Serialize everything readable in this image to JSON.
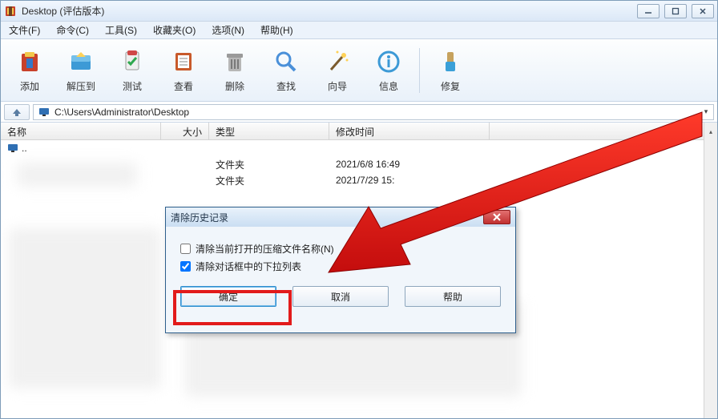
{
  "window": {
    "title": "Desktop (评估版本)"
  },
  "menubar": {
    "items": [
      "文件(F)",
      "命令(C)",
      "工具(S)",
      "收藏夹(O)",
      "选项(N)",
      "帮助(H)"
    ]
  },
  "toolbar": {
    "items": [
      {
        "label": "添加",
        "icon": "add-archive-icon"
      },
      {
        "label": "解压到",
        "icon": "extract-icon"
      },
      {
        "label": "测试",
        "icon": "test-icon"
      },
      {
        "label": "查看",
        "icon": "view-icon"
      },
      {
        "label": "删除",
        "icon": "delete-icon"
      },
      {
        "label": "查找",
        "icon": "find-icon"
      },
      {
        "label": "向导",
        "icon": "wizard-icon"
      },
      {
        "label": "信息",
        "icon": "info-icon"
      },
      {
        "label": "修复",
        "icon": "repair-icon"
      }
    ]
  },
  "address": {
    "path": "C:\\Users\\Administrator\\Desktop"
  },
  "listview": {
    "columns": {
      "name": "名称",
      "size": "大小",
      "type": "类型",
      "date": "修改时间"
    },
    "rows": [
      {
        "name": "..",
        "size": "",
        "type": "",
        "date": ""
      },
      {
        "name": "",
        "size": "",
        "type": "文件夹",
        "date": "2021/6/8 16:49"
      },
      {
        "name": "",
        "size": "",
        "type": "文件夹",
        "date": "2021/7/29 15:"
      }
    ]
  },
  "dialog": {
    "title": "清除历史记录",
    "check1_label": "清除当前打开的压缩文件名称(N)",
    "check2_label": "清除对话框中的下拉列表",
    "check1_checked": false,
    "check2_checked": true,
    "ok": "确定",
    "cancel": "取消",
    "help": "帮助"
  }
}
